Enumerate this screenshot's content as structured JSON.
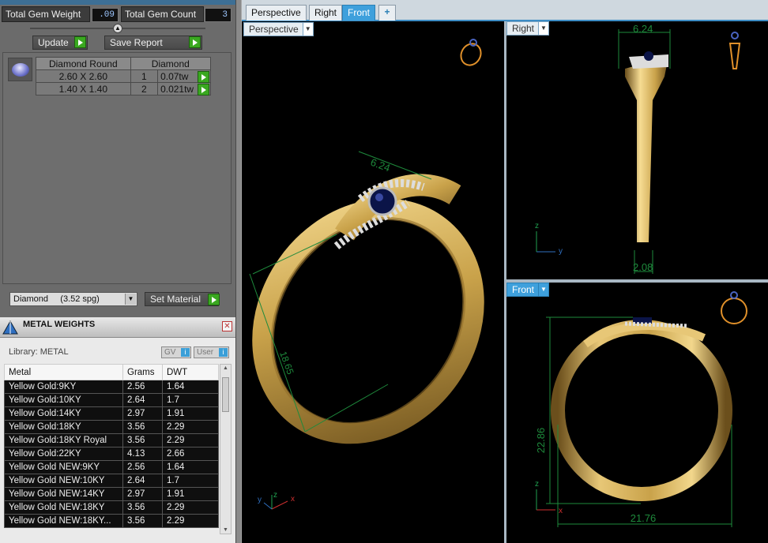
{
  "gem_panel": {
    "total_weight_label": "Total Gem Weight",
    "total_weight_value": ".09",
    "total_count_label": "Total Gem Count",
    "total_count_value": "3",
    "update_label": "Update",
    "save_report_label": "Save Report",
    "table_headers": [
      "Diamond Round",
      "Diamond"
    ],
    "rows": [
      {
        "size": "2.60 X 2.60",
        "qty": "1",
        "weight": "0.07tw"
      },
      {
        "size": "1.40 X 1.40",
        "qty": "2",
        "weight": "0.021tw"
      }
    ],
    "material_select": "Diamond     (3.52 spg)",
    "set_material_label": "Set Material"
  },
  "metal_weights": {
    "title": "METAL WEIGHTS",
    "library_label": "Library: METAL",
    "tag_gv": "GV",
    "tag_user": "User",
    "columns": [
      "Metal",
      "Grams",
      "DWT"
    ],
    "rows": [
      [
        "Yellow Gold:9KY",
        "2.56",
        "1.64"
      ],
      [
        "Yellow Gold:10KY",
        "2.64",
        "1.7"
      ],
      [
        "Yellow Gold:14KY",
        "2.97",
        "1.91"
      ],
      [
        "Yellow Gold:18KY",
        "3.56",
        "2.29"
      ],
      [
        "Yellow Gold:18KY Royal",
        "3.56",
        "2.29"
      ],
      [
        "Yellow Gold:22KY",
        "4.13",
        "2.66"
      ],
      [
        "Yellow Gold NEW:9KY",
        "2.56",
        "1.64"
      ],
      [
        "Yellow Gold NEW:10KY",
        "2.64",
        "1.7"
      ],
      [
        "Yellow Gold NEW:14KY",
        "2.97",
        "1.91"
      ],
      [
        "Yellow Gold NEW:18KY",
        "3.56",
        "2.29"
      ],
      [
        "Yellow Gold NEW:18KY...",
        "3.56",
        "2.29"
      ]
    ]
  },
  "tabs": [
    "Perspective",
    "Right",
    "Front"
  ],
  "active_tab": "Front",
  "viewports": {
    "perspective": {
      "label": "Perspective",
      "dim_top": "6.24",
      "dim_side": "18.65"
    },
    "right": {
      "label": "Right",
      "dim_top": "6.24",
      "dim_bottom": "2.08"
    },
    "front": {
      "label": "Front",
      "dim_height": "22.86",
      "dim_width": "21.76"
    }
  },
  "axes": {
    "x": "x",
    "y": "y",
    "z": "z"
  },
  "colors": {
    "gold": "#c9a24a",
    "measure": "#1e8a3c",
    "accent": "#3ea0dc"
  }
}
